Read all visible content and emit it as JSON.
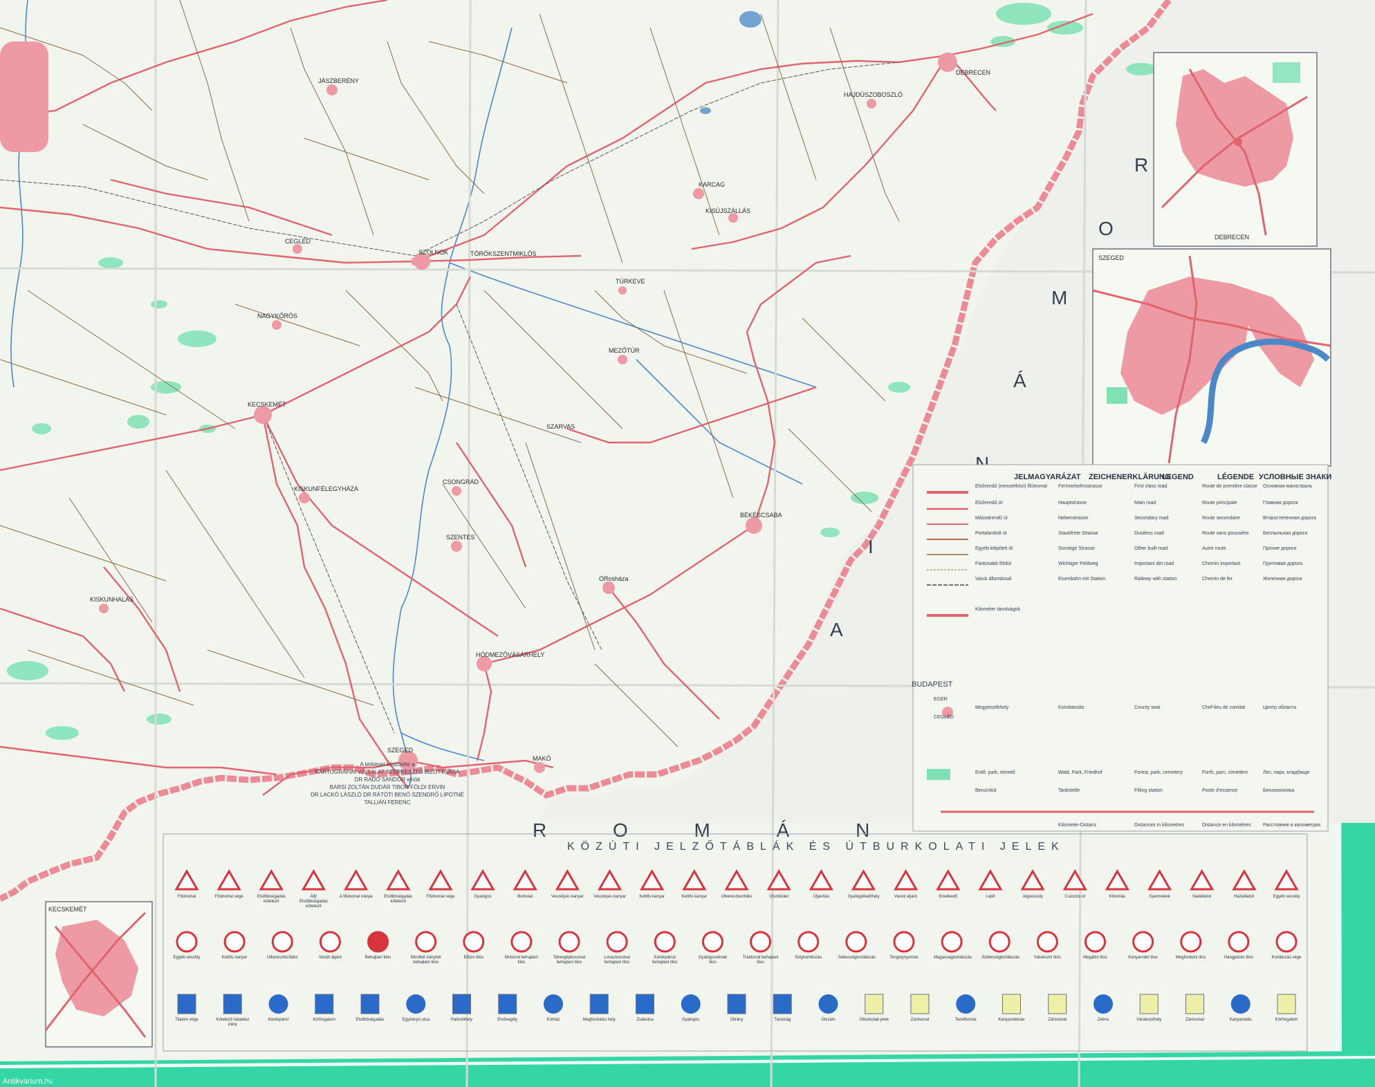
{
  "colors": {
    "paper": "#f2f4ee",
    "border_band": "#33d6a4",
    "romania_border": "#ec8a96",
    "main_road": "#e0646e",
    "minor_road": "#8a6a44",
    "water": "#4a88c8",
    "forest": "#7ee2b4",
    "town_fill": "#ee9aa4"
  },
  "cities": [
    {
      "name": "SZOLNOK"
    },
    {
      "name": "CEGLÉD"
    },
    {
      "name": "KECSKEMÉT"
    },
    {
      "name": "NAGYKŐRÖS"
    },
    {
      "name": "TÖRÖKSZENTMIKLÓS"
    },
    {
      "name": "KARCAG"
    },
    {
      "name": "KISÚJSZÁLLÁS"
    },
    {
      "name": "DEBRECEN"
    },
    {
      "name": "HAJDÚSZOBOSZLÓ"
    },
    {
      "name": "TÚRKEVE"
    },
    {
      "name": "MEZŐTÚR"
    },
    {
      "name": "KISKUNFÉLEGYHÁZA"
    },
    {
      "name": "CSONGRÁD"
    },
    {
      "name": "SZENTES"
    },
    {
      "name": "ORosháza"
    },
    {
      "name": "BÉKÉSCSABA"
    },
    {
      "name": "HÓDMEZŐVÁSÁRHELY"
    },
    {
      "name": "SZEGED"
    },
    {
      "name": "MAKÓ"
    },
    {
      "name": "KISKUNHALAS"
    },
    {
      "name": "JÁSZBERÉNY"
    },
    {
      "name": "SZARVAS"
    }
  ],
  "country_labels": {
    "romania_letters": [
      "R",
      "O",
      "M",
      "Á",
      "N",
      "I",
      "A"
    ],
    "bottom_text": "R O M Á N"
  },
  "insets": {
    "debrecen": "DEBRECEN",
    "szeged": "SZEGED",
    "kecskemet": "KECSKEMÉT"
  },
  "legend": {
    "headers": [
      "JELMAGYARÁZAT",
      "ZEICHENERKLÄRUNG",
      "LEGEND",
      "LÉGENDE",
      "УСЛОВНЫЕ ЗНАКИ"
    ],
    "rows": [
      {
        "hu": "Elsőrendű (nemzetközi) főútvonal",
        "de": "Fernverkehrsstrasse",
        "en": "First class road",
        "fr": "Route de première classe",
        "ru": "Основная магистраль"
      },
      {
        "hu": "Elsőrendű út",
        "de": "Hauptstrasse",
        "en": "Main road",
        "fr": "Route principale",
        "ru": "Главная дорога"
      },
      {
        "hu": "Másodrendű út",
        "de": "Nebenstrasse",
        "en": "Secondary road",
        "fr": "Route secondaire",
        "ru": "Второстепенная дорога"
      },
      {
        "hu": "Portalanított út",
        "de": "Staubfreie Strasse",
        "en": "Dustless road",
        "fr": "Route sans poussière",
        "ru": "Беспыльная дорога"
      },
      {
        "hu": "Egyéb kiépített út",
        "de": "Sonstige Strasse",
        "en": "Other built road",
        "fr": "Autre route",
        "ru": "Прочие дороги"
      },
      {
        "hu": "Fontosabb földút",
        "de": "Wichtiger Feldweg",
        "en": "Important dirt road",
        "fr": "Chemin important",
        "ru": "Грунтовая дорога"
      },
      {
        "hu": "Vasút állomással",
        "de": "Eisenbahn mit Station",
        "en": "Railway with station",
        "fr": "Chemin de fer",
        "ru": "Железная дорога"
      },
      {
        "hu": "Kilométer távolságok",
        "de": "Kilometer-Distanz",
        "en": "Distances in kilometres",
        "fr": "Distance en kilomètres",
        "ru": "Расстояние в километрах"
      },
      {
        "hu": "Megyeszékhely",
        "de": "Komitatssitz",
        "en": "County seat",
        "fr": "Chef-lieu de comitat",
        "ru": "Центр области"
      },
      {
        "hu": "Erdő, park, temető",
        "de": "Wald, Park, Friedhof",
        "en": "Forest, park, cemetery",
        "fr": "Forêt, parc, cimetière",
        "ru": "Лес, парк, кладбище"
      },
      {
        "hu": "Benzinkút",
        "de": "Tankstelle",
        "en": "Filling station",
        "fr": "Poste d'essence",
        "ru": "Бензоколонка"
      }
    ],
    "city_sample": "BUDAPEST",
    "eger_sample": "EGER",
    "cegled_sample": "CEGLÉD"
  },
  "signs": {
    "title": "KÖZÚTI JELZŐTÁBLÁK ÉS ÚTBURKOLATI JELEK",
    "row1_labels": [
      "Főútvonal",
      "Főútvonal vége",
      "Elsőbbségadás kötelező",
      "Állj! Elsőbbségadás kötelező",
      "A főútvonal iránya",
      "Elsőbbségadás kötelező",
      "Főútvonal vége",
      "Gyalogos",
      "Burkolat",
      "Veszélyes kanyar",
      "Veszélyes kanyar",
      "Kettős kanyar",
      "Kettős kanyar",
      "Útkereszteződés",
      "Útszűkület",
      "Útjavítás",
      "Gyalogátkelőhely",
      "Vasúti átjáró",
      "Emelkedő",
      "Lejtő",
      "Jégveszély",
      "Csúszós út",
      "Kőomlás",
      "Gyermekek",
      "Vadállatok",
      "Háziállatok",
      "Egyéb veszély"
    ],
    "row2_labels": [
      "Egyéb veszély",
      "Kettős kanyar",
      "Útkereszteződés",
      "Vasúti átjáró",
      "Behajtani tilos",
      "Mindkét irányból behajtani tilos",
      "Előzni tilos",
      "Motorral behajtani tilos",
      "Tehergépkocsival behajtani tilos",
      "Lovaskocsival behajtani tilos",
      "Kerékpárral behajtani tilos",
      "Gyalogosoknak tilos",
      "Traktorral behajtani tilos",
      "Súlykorlátozás",
      "Sebességkorlátozás",
      "Tengelynyomás",
      "Magasságkorlátozás",
      "Szélességkorlátozás",
      "Várakozni tilos",
      "Megállni tilos",
      "Kanyarodni tilos",
      "Megfordulni tilos",
      "Hangjelzés tilos",
      "Korlátozás vége"
    ],
    "row3_labels": [
      "Tilalom vége",
      "Kötelező haladási irány",
      "Kerékpárút",
      "Körforgalom",
      "Elsőbbségadás",
      "Egyirányú utca",
      "Parkolóhely",
      "Elsősegély",
      "Kórház",
      "Megfordulási hely",
      "Zsákutca",
      "Gyalogos",
      "Útirány",
      "Távolság",
      "Útszám",
      "Útburkolati jelek",
      "Záróvonal",
      "Terelővonal",
      "Kanyarodósáv",
      "Záróvonal",
      "Zebra",
      "Várakozóhely",
      "Záróvonal",
      "Kanyarodás",
      "Körforgalom"
    ]
  },
  "credits": {
    "line1": "A térképet készítette a",
    "line2": "KARTOGRÁFIAI VÁLLALAT SZERKESZTŐ BIZOTTSÁGA",
    "line3": "DR RADÓ SÁNDOR elnök",
    "line4": "BARSI ZOLTÁN DUDÁR TIBOR FÖLDI ERVIN",
    "line5": "DR LACKÓ LÁSZLÓ DR RÁTÓTI BENŐ SZENDRŐ LIPÓTNÉ",
    "line6": "TALLIÁN FERENC"
  },
  "watermark": "Antikvarium.hu"
}
